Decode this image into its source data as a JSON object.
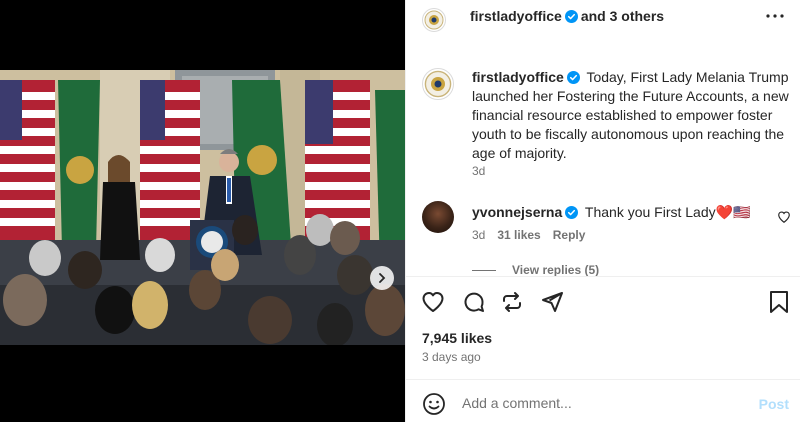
{
  "header": {
    "username": "firstladyoffice",
    "others": "and 3 others",
    "more_icon": "more-horizontal-icon"
  },
  "caption": {
    "username": "firstladyoffice",
    "text": "Today, First Lady Melania Trump launched her Fostering the Future Accounts, a new financial resource established to empower foster youth to be fiscally autonomous upon reaching the age of majority.",
    "time": "3d"
  },
  "comment": {
    "username": "yvonnejserna",
    "text": "Thank you First Lady❤️🇺🇸",
    "time": "3d",
    "likes": "31 likes",
    "reply_label": "Reply",
    "view_replies": "View replies (5)"
  },
  "post": {
    "likes": "7,945 likes",
    "date": "3 days ago"
  },
  "add_comment": {
    "placeholder": "Add a comment...",
    "post_label": "Post"
  },
  "carousel": {
    "slides": 4,
    "active_index": 0
  },
  "colors": {
    "verified": "#0095f6",
    "post_disabled": "#b2dffc",
    "secondary_text": "#737373"
  }
}
